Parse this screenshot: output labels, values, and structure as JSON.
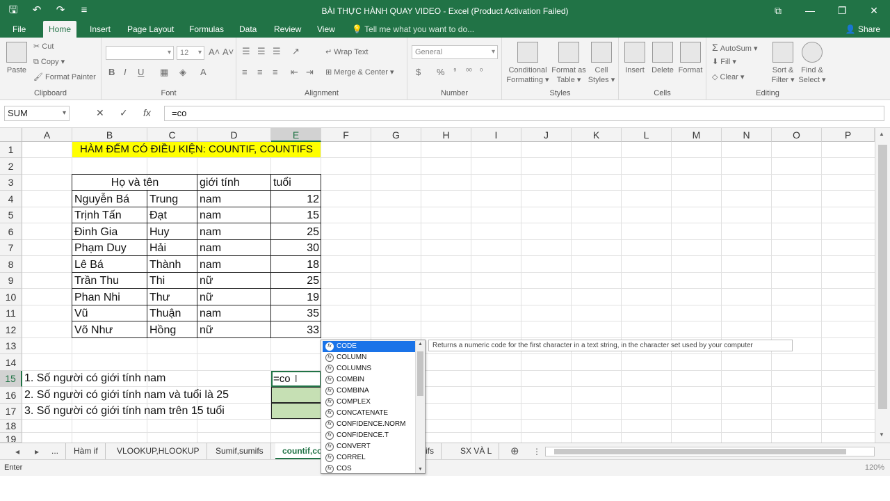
{
  "window": {
    "title": "BÀI THỰC HÀNH QUAY VIDEO - Excel (Product Activation Failed)",
    "accent": "#217346"
  },
  "ribbon_tabs": [
    {
      "label": "File"
    },
    {
      "label": "Home"
    },
    {
      "label": "Insert"
    },
    {
      "label": "Page Layout"
    },
    {
      "label": "Formulas"
    },
    {
      "label": "Data"
    },
    {
      "label": "Review"
    },
    {
      "label": "View"
    }
  ],
  "tell_me": "Tell me what you want to do...",
  "share": "Share",
  "ribbon": {
    "clipboard": {
      "paste": "Paste",
      "cut": "Cut",
      "copy": "Copy",
      "format_painter": "Format Painter",
      "label": "Clipboard"
    },
    "font": {
      "size": "12",
      "label": "Font"
    },
    "alignment": {
      "wrap": "Wrap Text",
      "merge": "Merge & Center",
      "label": "Alignment"
    },
    "number": {
      "format": "General",
      "label": "Number"
    },
    "styles": {
      "conditional": "Conditional",
      "conditional2": "Formatting",
      "format_as": "Format as",
      "format_as2": "Table",
      "cell": "Cell",
      "cell2": "Styles",
      "label": "Styles"
    },
    "cells": {
      "insert": "Insert",
      "delete": "Delete",
      "format": "Format",
      "label": "Cells"
    },
    "editing": {
      "autosum": "AutoSum",
      "fill": "Fill",
      "clear": "Clear",
      "sort": "Sort &",
      "sort2": "Filter",
      "find": "Find &",
      "find2": "Select",
      "label": "Editing"
    }
  },
  "formula_bar": {
    "name_box": "SUM",
    "formula": "=co"
  },
  "columns": [
    "A",
    "B",
    "C",
    "D",
    "E",
    "F",
    "G",
    "H",
    "I",
    "J",
    "K",
    "L",
    "M",
    "N",
    "O",
    "P"
  ],
  "rows": [
    "1",
    "2",
    "3",
    "4",
    "5",
    "6",
    "7",
    "8",
    "9",
    "10",
    "11",
    "12",
    "13",
    "14",
    "15",
    "16",
    "17",
    "18",
    "19"
  ],
  "sheet": {
    "title": "HÀM ĐẾM CÓ ĐIỀU KIỆN: COUNTIF, COUNTIFS",
    "headers": {
      "name": "Họ và tên",
      "gender": "giới tính",
      "age": "tuổi"
    },
    "people": [
      {
        "last": "Nguyễn Bá",
        "first": "Trung",
        "gender": "nam",
        "age": "12"
      },
      {
        "last": "Trịnh Tấn",
        "first": "Đạt",
        "gender": "nam",
        "age": "15"
      },
      {
        "last": "Đinh Gia",
        "first": "Huy",
        "gender": "nam",
        "age": "25"
      },
      {
        "last": "Phạm Duy",
        "first": "Hải",
        "gender": "nam",
        "age": "30"
      },
      {
        "last": "Lê Bá",
        "first": "Thành",
        "gender": "nam",
        "age": "18"
      },
      {
        "last": "Trần Thu",
        "first": "Thi",
        "gender": "nữ",
        "age": "25"
      },
      {
        "last": "Phan Nhi",
        "first": "Thư",
        "gender": "nữ",
        "age": "19"
      },
      {
        "last": "Vũ",
        "first": "Thuận",
        "gender": "nam",
        "age": "35"
      },
      {
        "last": "Võ Như",
        "first": "Hồng",
        "gender": "nữ",
        "age": "33"
      }
    ],
    "questions": [
      "1. Số người có giới tính nam",
      "2. Số người có giới tính nam và tuổi là 25",
      "3. Số người có giới tính nam trên 15 tuổi"
    ],
    "editing_value": "=co",
    "title_fill": "#ffff00",
    "answer_fill": "#c6e0b4"
  },
  "autocomplete": {
    "items": [
      "CODE",
      "COLUMN",
      "COLUMNS",
      "COMBIN",
      "COMBINA",
      "COMPLEX",
      "CONCATENATE",
      "CONFIDENCE.NORM",
      "CONFIDENCE.T",
      "CONVERT",
      "CORREL",
      "COS"
    ],
    "selected": "CODE",
    "tooltip": "Returns a numeric code for the first character in a text string, in the character set used by your computer"
  },
  "sheet_tabs": [
    "...",
    "Hàm if",
    "VLOOKUP,HLOOKUP",
    "Sumif,sumifs",
    "countif,co",
    "ifs",
    "SX VÀ L"
  ],
  "active_tab": "countif,co",
  "status": {
    "mode": "Enter",
    "zoom": "120%"
  }
}
